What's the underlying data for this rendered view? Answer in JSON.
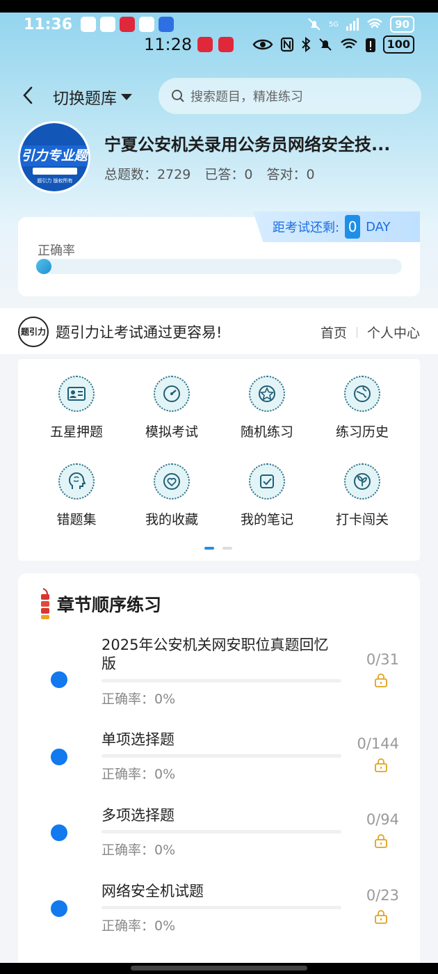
{
  "status_bar_top": {
    "time": "11:36",
    "battery": "90",
    "network": "5G"
  },
  "status_bar_inner": {
    "time": "11:28",
    "battery": "100"
  },
  "header": {
    "switch_label": "切换题库",
    "search_placeholder": "搜索题目，精准练习"
  },
  "bank": {
    "logo_text": "引力专业题",
    "logo_sub": "题引力 版权所有",
    "title": "宁夏公安机关录用公务员网络安全技...",
    "stats": [
      "总题数：2729",
      "已答：0",
      "答对：0"
    ]
  },
  "rate_card": {
    "countdown_label": "距考试还剩:",
    "countdown_value": "0",
    "countdown_unit": "DAY",
    "rate_label": "正确率",
    "rate_fraction": 0
  },
  "slogan_bar": {
    "logo_text": "题引力",
    "slogan": "题引力让考试通过更容易!",
    "links": [
      "首页",
      "个人中心"
    ]
  },
  "features": [
    {
      "label": "五星押题",
      "icon": "id-card-icon"
    },
    {
      "label": "模拟考试",
      "icon": "speedometer-icon"
    },
    {
      "label": "随机练习",
      "icon": "star-compass-icon"
    },
    {
      "label": "练习历史",
      "icon": "globe-icon"
    },
    {
      "label": "错题集",
      "icon": "brain-head-icon"
    },
    {
      "label": "我的收藏",
      "icon": "heart-icon"
    },
    {
      "label": "我的笔记",
      "icon": "note-check-icon"
    },
    {
      "label": "打卡闯关",
      "icon": "leaf-badge-icon"
    }
  ],
  "chapters": {
    "title": "章节顺序练习",
    "items": [
      {
        "name": "2025年公安机关网安职位真题回忆版",
        "accuracy": "正确率：0%",
        "count": "0/31"
      },
      {
        "name": "单项选择题",
        "accuracy": "正确率：0%",
        "count": "0/144"
      },
      {
        "name": "多项选择题",
        "accuracy": "正确率：0%",
        "count": "0/94"
      },
      {
        "name": "网络安全机试题",
        "accuracy": "正确率：0%",
        "count": "0/23"
      }
    ]
  },
  "colors": {
    "accent": "#1279ee",
    "lock": "#e0a21b"
  }
}
